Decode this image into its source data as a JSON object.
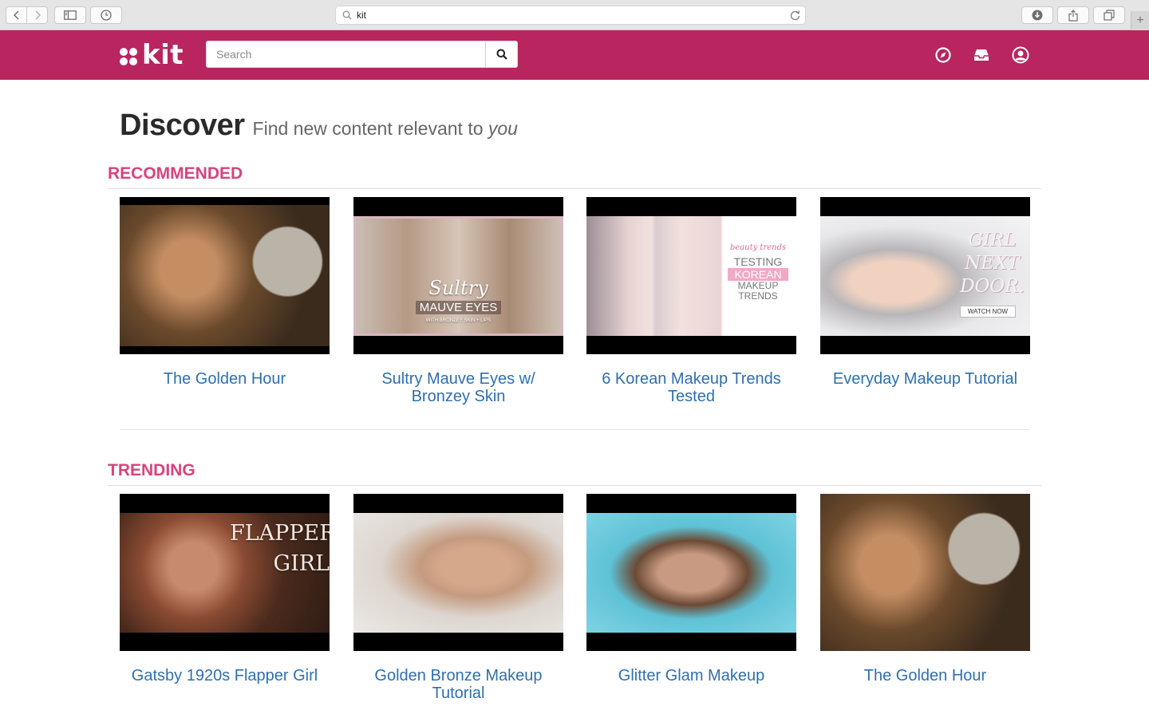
{
  "browser": {
    "url": "kit"
  },
  "header": {
    "logo_text": "kit",
    "search_placeholder": "Search",
    "brand_color": "#b8255f"
  },
  "page": {
    "title": "Discover",
    "subtitle_prefix": "Find new content relevant to ",
    "subtitle_emph": "you"
  },
  "sections": [
    {
      "heading": "RECOMMENDED",
      "items": [
        {
          "title": "The Golden Hour",
          "thumb_text": ""
        },
        {
          "title": "Sultry Mauve Eyes w/ Bronzey Skin",
          "thumb_text": "Sultry",
          "thumb_text2": "MAUVE EYES",
          "thumb_text3": "WITH BRONZEY SKIN + LIPS"
        },
        {
          "title": "6 Korean Makeup Trends Tested",
          "thumb_text": "beauty trends",
          "thumb_text2": "TESTING",
          "thumb_text3": "KOREAN",
          "thumb_text4": "MAKEUP",
          "thumb_text5": "TRENDS"
        },
        {
          "title": "Everyday Makeup Tutorial",
          "thumb_text": "GIRL",
          "thumb_text2": "NEXT",
          "thumb_text3": "DOOR.",
          "thumb_text4": "WATCH NOW"
        }
      ]
    },
    {
      "heading": "TRENDING",
      "items": [
        {
          "title": "Gatsby 1920s Flapper Girl",
          "thumb_text": "FLAPPER",
          "thumb_text2": "GIRL"
        },
        {
          "title": "Golden Bronze Makeup Tutorial",
          "thumb_text": ""
        },
        {
          "title": "Glitter Glam Makeup",
          "thumb_text": ""
        },
        {
          "title": "The Golden Hour",
          "thumb_text": ""
        }
      ]
    }
  ],
  "colors": {
    "section_heading": "#d8437e",
    "link": "#2f6fae"
  }
}
